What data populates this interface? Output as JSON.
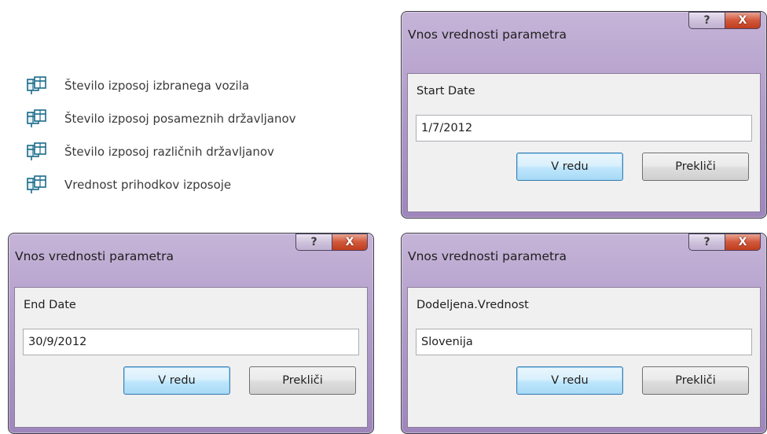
{
  "query_list": {
    "items": [
      {
        "label": "Število izposoj izbranega vozila",
        "icon": "query-icon"
      },
      {
        "label": "Število izposoj posameznih državljanov",
        "icon": "query-icon"
      },
      {
        "label": "Število izposoj različnih državljanov",
        "icon": "query-icon"
      },
      {
        "label": "Vrednost prihodkov izposoje",
        "icon": "query-icon"
      }
    ]
  },
  "dialogs": [
    {
      "title": "Vnos vrednosti parametra",
      "help_glyph": "?",
      "close_glyph": "X",
      "param_label": "Start Date",
      "param_value": "1/7/2012",
      "ok_label": "V redu",
      "cancel_label": "Prekliči"
    },
    {
      "title": "Vnos vrednosti parametra",
      "help_glyph": "?",
      "close_glyph": "X",
      "param_label": "End Date",
      "param_value": "30/9/2012",
      "ok_label": "V redu",
      "cancel_label": "Prekliči"
    },
    {
      "title": "Vnos vrednosti parametra",
      "help_glyph": "?",
      "close_glyph": "X",
      "param_label": "Dodeljena.Vrednost",
      "param_value": "Slovenija",
      "ok_label": "V redu",
      "cancel_label": "Prekliči"
    }
  ],
  "colors": {
    "dialog_frame": "#ad98c6",
    "close_button": "#c8472a",
    "ok_button_border": "#3c7fb1",
    "query_icon": "#1a6b8a"
  }
}
